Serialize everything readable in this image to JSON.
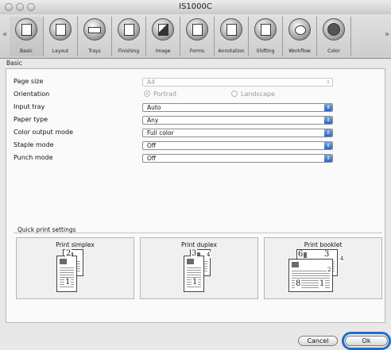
{
  "window": {
    "title": "IS1000C"
  },
  "toolbar": {
    "items": [
      {
        "label": "Basic",
        "icon": "document-icon"
      },
      {
        "label": "Layout",
        "icon": "layout-icon"
      },
      {
        "label": "Trays",
        "icon": "trays-icon"
      },
      {
        "label": "Finishing",
        "icon": "finishing-icon"
      },
      {
        "label": "Image",
        "icon": "image-icon"
      },
      {
        "label": "Forms",
        "icon": "forms-icon"
      },
      {
        "label": "Annotation",
        "icon": "annotation-icon"
      },
      {
        "label": "Shifting",
        "icon": "shifting-icon"
      },
      {
        "label": "Workflow",
        "icon": "workflow-icon"
      },
      {
        "label": "Color",
        "icon": "color-icon"
      }
    ]
  },
  "section_title": "Basic",
  "settings": {
    "page_size": {
      "label": "Page size",
      "value": "A4"
    },
    "orientation": {
      "label": "Orientation",
      "option1": "Portrait",
      "option2": "Landscape"
    },
    "input_tray": {
      "label": "Input tray",
      "value": "Auto"
    },
    "paper_type": {
      "label": "Paper type",
      "value": "Any"
    },
    "color_output_mode": {
      "label": "Color output mode",
      "value": "Full color"
    },
    "staple_mode": {
      "label": "Staple mode",
      "value": "Off"
    },
    "punch_mode": {
      "label": "Punch mode",
      "value": "Off"
    }
  },
  "quick_print": {
    "title": "Quick print settings",
    "options": [
      {
        "label": "Print simplex",
        "back_page": "2",
        "front_page": "1"
      },
      {
        "label": "Print duplex",
        "back_page": "3",
        "front_page": "1",
        "corner": "4"
      },
      {
        "label": "Print booklet",
        "back_left": "6",
        "back_right": "3",
        "front_left": "8",
        "front_right": "1",
        "corner_right": "4",
        "corner_mid": "2"
      }
    ]
  },
  "buttons": {
    "cancel": "Cancel",
    "ok": "Ok"
  },
  "colors": {
    "accent": "#1d70c8",
    "select_arrow": "#2b63c4"
  }
}
